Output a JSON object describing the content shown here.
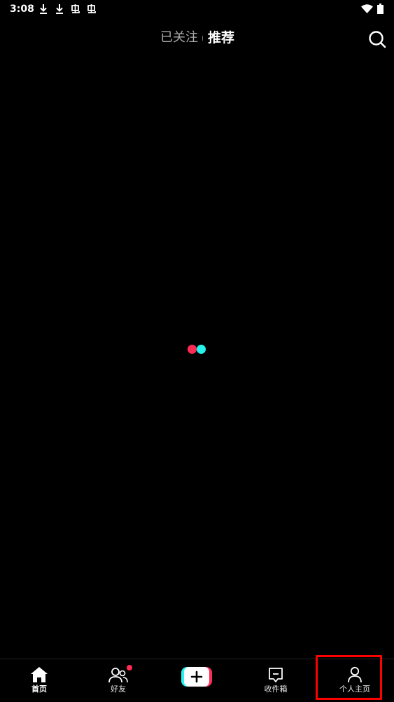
{
  "status_bar": {
    "time": "3:08",
    "icons": [
      "download-icon",
      "download-icon",
      "bug-icon",
      "bug-icon",
      "wifi-icon",
      "battery-icon"
    ]
  },
  "top_tabs": {
    "following_label": "已关注",
    "recommend_label": "推荐",
    "active": "recommend"
  },
  "search": {
    "icon": "search-icon"
  },
  "loading": {
    "colors": [
      "#fe2c55",
      "#25f4ee"
    ]
  },
  "bottom_nav": {
    "items": [
      {
        "label": "首页",
        "icon": "home-icon",
        "active": true
      },
      {
        "label": "好友",
        "icon": "friends-icon",
        "badge": true
      },
      {
        "label": "",
        "icon": "plus-icon"
      },
      {
        "label": "收件箱",
        "icon": "inbox-icon"
      },
      {
        "label": "个人主页",
        "icon": "profile-icon",
        "highlighted": true
      }
    ]
  },
  "colors": {
    "background": "#000000",
    "accent_red": "#fe2c55",
    "accent_cyan": "#25f4ee",
    "highlight": "#ff0000"
  }
}
